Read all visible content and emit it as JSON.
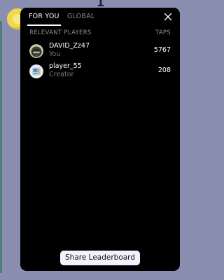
{
  "tabs": [
    {
      "label": "FOR YOU",
      "active": true
    },
    {
      "label": "GLOBAL",
      "active": false
    }
  ],
  "header": {
    "players_label": "RELEVANT PLAYERS",
    "taps_label": "TAPS"
  },
  "players": [
    {
      "name": "DAVID_Zz47",
      "subtitle": "You",
      "taps": "5767",
      "avatar_icon": "racing-helmet-avatar"
    },
    {
      "name": "player_55",
      "subtitle": "Creator",
      "taps": "208",
      "avatar_icon": "player-avatar"
    }
  ],
  "share_button_label": "Share Leaderboard",
  "background": {
    "visible_number": "1"
  },
  "colors": {
    "panel_bg": "#000000",
    "page_bg": "#8a8fb2",
    "button_bg": "#f4f1ff",
    "muted_text": "#8e8e8e"
  }
}
